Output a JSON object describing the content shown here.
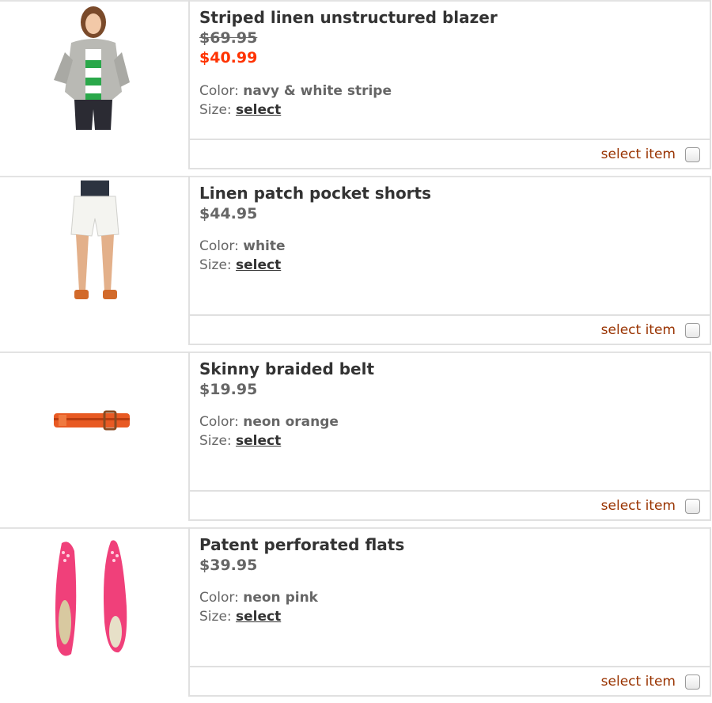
{
  "items": [
    {
      "title": "Striped linen unstructured blazer",
      "price_original": "$69.95",
      "price_sale": "$40.99",
      "color_label": "Color:",
      "color_value": "navy & white stripe",
      "size_label": "Size:",
      "size_value": "select",
      "select_label": "select item",
      "image": "woman-in-striped-blazer"
    },
    {
      "title": "Linen patch pocket shorts",
      "price": "$44.95",
      "color_label": "Color:",
      "color_value": "white",
      "size_label": "Size:",
      "size_value": "select",
      "select_label": "select item",
      "image": "woman-in-white-shorts"
    },
    {
      "title": "Skinny braided belt",
      "price": "$19.95",
      "color_label": "Color:",
      "color_value": "neon orange",
      "size_label": "Size:",
      "size_value": "select",
      "select_label": "select item",
      "image": "orange-braided-belt"
    },
    {
      "title": "Patent perforated flats",
      "price": "$39.95",
      "color_label": "Color:",
      "color_value": "neon pink",
      "size_label": "Size:",
      "size_value": "select",
      "select_label": "select item",
      "image": "pink-patent-flats"
    }
  ],
  "colors": {
    "sale_price": "#ff3300",
    "select_item_text": "#993300"
  }
}
